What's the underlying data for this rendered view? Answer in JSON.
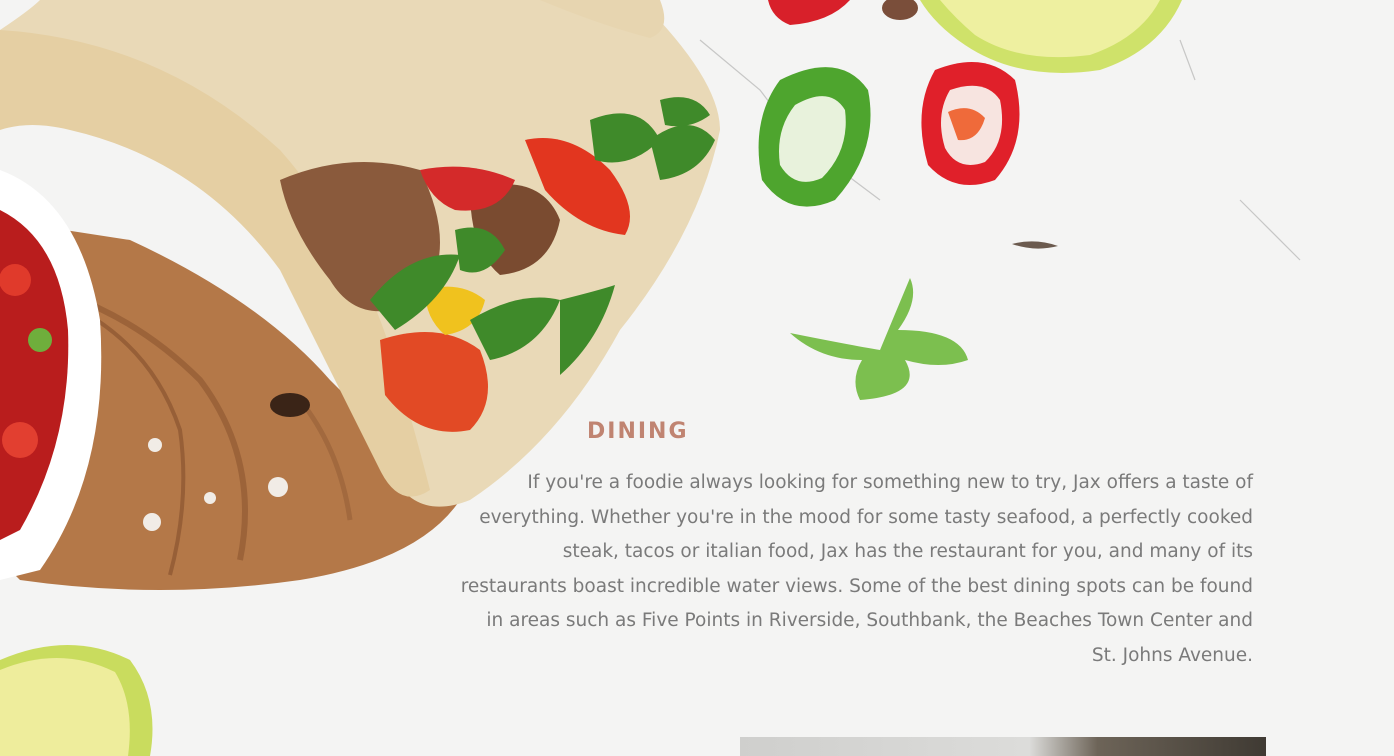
{
  "dining": {
    "title": "DINING",
    "body": "If you're a foodie always looking for something new to try, Jax offers a taste of everything. Whether you're in the mood for some tasty seafood, a perfectly cooked steak, tacos or italian food, Jax has the restaurant for you, and many of its restaurants boast incredible water views. Some of the best dining spots can be found in areas such as Five Points in Riverside, Southbank, the Beaches Town Center and St. Johns Avenue."
  },
  "colors": {
    "accent": "#c08471",
    "body_text": "#7a7a7a",
    "background": "#f4f4f3"
  }
}
